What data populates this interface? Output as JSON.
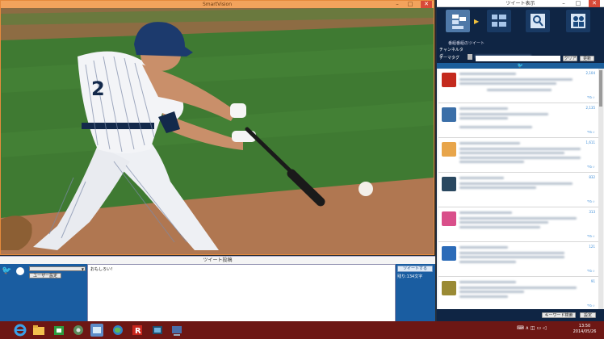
{
  "video_window": {
    "title": "SmartVision",
    "minimize": "–",
    "maximize": "□",
    "close": "✕"
  },
  "tweet_window": {
    "title": "ツイート表示",
    "minimize": "–",
    "maximize": "□",
    "close": "✕",
    "view_modes": [
      "tweets-of-program-icon",
      "list-view-icon",
      "search-user-icon",
      "people-icon"
    ],
    "mode_caption": "番組番組のツイート",
    "channel_tag_label": "チャンネルタグ",
    "theme_tag_label": "テーマタグ",
    "theme_tag_value": "",
    "clear_label": "クリア",
    "refresh_label": "更新",
    "bird": "🐦",
    "keyword_button": "キーワード検索",
    "settings_button": "設定",
    "tweets": [
      {
        "count": "2,104",
        "retweet": "↰↻☆"
      },
      {
        "count": "2,135",
        "retweet": "↰↻☆"
      },
      {
        "count": "1,611",
        "retweet": "↰↻☆"
      },
      {
        "count": "832",
        "retweet": "↰↻☆"
      },
      {
        "count": "313",
        "retweet": "↰↻☆"
      },
      {
        "count": "121",
        "retweet": "↰↻☆"
      },
      {
        "count": "91",
        "retweet": "↰↻☆"
      },
      {
        "count": "",
        "retweet": "↰↻☆"
      }
    ],
    "avatar_colors": [
      "#c42a1e",
      "#3b6fa8",
      "#e8a54a",
      "#2a4860",
      "#d94f8a",
      "#2b6bb8",
      "#9a8a34",
      "#6aa04a"
    ]
  },
  "post_window": {
    "title": "ツイート投稿",
    "bird": "🐦",
    "account_select": "",
    "user_settings_button": "ユーザー設定",
    "post_text": "おもしろい！",
    "tweet_button": "ツイートする",
    "remaining": "残り:134文字"
  },
  "taskbar": {
    "tray": "⌨ ∧ ◫ ▭ ◁",
    "time": "13:50",
    "date": "2014/05/26"
  }
}
